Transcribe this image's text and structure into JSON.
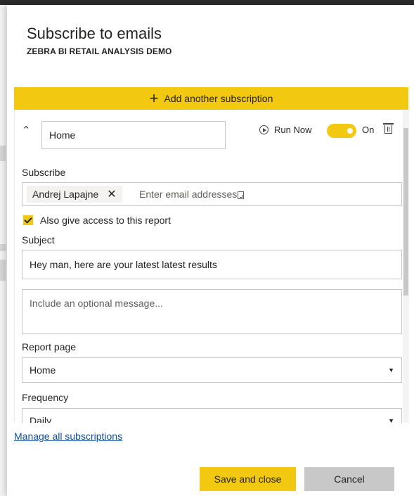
{
  "dialog": {
    "title": "Subscribe to emails",
    "report_name": "ZEBRA BI RETAIL ANALYSIS DEMO",
    "add_subscription_label": "Add another subscription"
  },
  "subscription": {
    "name_value": "Home",
    "run_now_label": "Run Now",
    "toggle_state": "On",
    "subscribe_label": "Subscribe",
    "recipients": [
      "Andrej Lapajne"
    ],
    "email_placeholder": "Enter email addresses",
    "access_checkbox_label": "Also give access to this report",
    "access_checked": true,
    "subject_label": "Subject",
    "subject_value": "Hey man, here are your latest latest results",
    "message_placeholder": "Include an optional message...",
    "report_page_label": "Report page",
    "report_page_value": "Home",
    "frequency_label": "Frequency",
    "frequency_value": "Daily"
  },
  "footer": {
    "manage_link": "Manage all subscriptions",
    "save_label": "Save and close",
    "cancel_label": "Cancel"
  },
  "colors": {
    "accent": "#f2c811",
    "link": "#0f4f9c",
    "cancel_bg": "#c8c8c8"
  },
  "icons": [
    "plus-icon",
    "chevron-up-icon",
    "play-circle-icon",
    "trash-icon",
    "close-icon",
    "input-helper-icon",
    "checkmark-icon",
    "dropdown-arrow-icon"
  ]
}
